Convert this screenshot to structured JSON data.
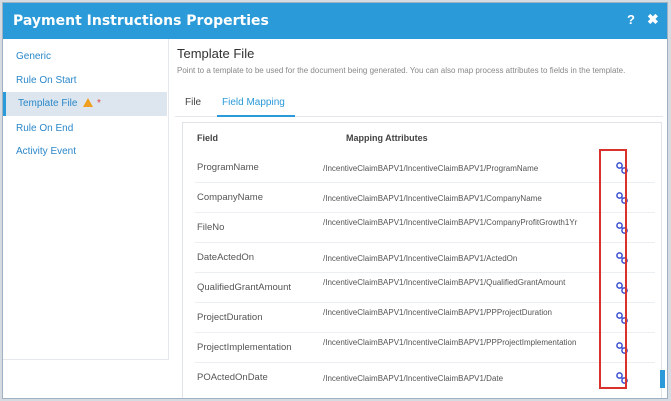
{
  "dialog": {
    "title": "Payment Instructions Properties",
    "help_label": "?",
    "close_label": "✖"
  },
  "sidebar": {
    "items": [
      {
        "label": "Generic"
      },
      {
        "label": "Rule On Start"
      },
      {
        "label": "Template File",
        "marker": "*"
      },
      {
        "label": "Rule On End"
      },
      {
        "label": "Activity Event"
      }
    ]
  },
  "main": {
    "section_title": "Template File",
    "section_desc": "Point to a template to be used for the document being generated. You can also map process attributes to fields in the template.",
    "tabs": [
      {
        "label": "File"
      },
      {
        "label": "Field Mapping"
      }
    ],
    "table": {
      "headers": {
        "field": "Field",
        "mapping": "Mapping Attributes"
      },
      "rows": [
        {
          "field": "ProgramName",
          "attr": "/IncentiveClaimBAPV1/IncentiveClaimBAPV1/ProgramName"
        },
        {
          "field": "CompanyName",
          "attr": "/IncentiveClaimBAPV1/IncentiveClaimBAPV1/CompanyName"
        },
        {
          "field": "FileNo",
          "attr": "/IncentiveClaimBAPV1/IncentiveClaimBAPV1/CompanyProfitGrowth1Yr"
        },
        {
          "field": "DateActedOn",
          "attr": "/IncentiveClaimBAPV1/IncentiveClaimBAPV1/ActedOn"
        },
        {
          "field": "QualifiedGrantAmount",
          "attr": "/IncentiveClaimBAPV1/IncentiveClaimBAPV1/QualifiedGrantAmount"
        },
        {
          "field": "ProjectDuration",
          "attr": "/IncentiveClaimBAPV1/IncentiveClaimBAPV1/PPProjectDuration"
        },
        {
          "field": "ProjectImplementation",
          "attr": "/IncentiveClaimBAPV1/IncentiveClaimBAPV1/PPProjectImplementation"
        },
        {
          "field": "POActedOnDate",
          "attr": "/IncentiveClaimBAPV1/IncentiveClaimBAPV1/Date"
        }
      ]
    }
  },
  "icons": {
    "row_action": "link-icon",
    "warning": "warning-icon"
  },
  "colors": {
    "accent": "#2a9ad8",
    "link": "#2a87c9",
    "icon": "#3a4fd0",
    "highlight": "#d9322c",
    "warning": "#f0a020"
  }
}
